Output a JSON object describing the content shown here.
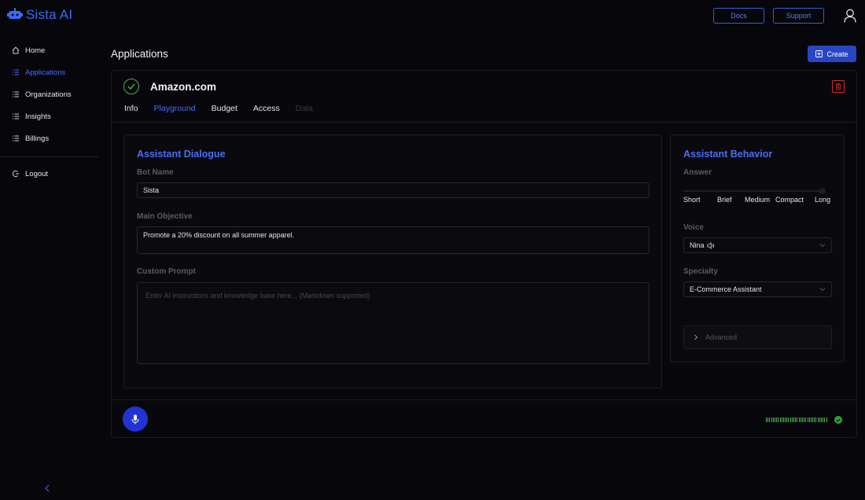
{
  "brand": {
    "name": "Sista AI",
    "accent": "#3b6cf6"
  },
  "sidebar": {
    "items": [
      {
        "label": "Home",
        "icon": "home-icon",
        "active": false
      },
      {
        "label": "Applications",
        "icon": "list-icon",
        "active": true
      },
      {
        "label": "Organizations",
        "icon": "list-icon",
        "active": false
      },
      {
        "label": "Insights",
        "icon": "list-icon",
        "active": false
      },
      {
        "label": "Billings",
        "icon": "list-icon",
        "active": false
      }
    ],
    "logout_label": "Logout",
    "collapse_icon": "chevron-left-icon"
  },
  "header": {
    "docs_label": "Docs",
    "support_label": "Support",
    "user_icon": "user-icon"
  },
  "page": {
    "title": "Applications",
    "create_label": "Create"
  },
  "app": {
    "name": "Amazon.com",
    "status_color": "#4caf50",
    "tabs": [
      {
        "label": "Info",
        "state": "normal"
      },
      {
        "label": "Playground",
        "state": "active"
      },
      {
        "label": "Budget",
        "state": "normal"
      },
      {
        "label": "Access",
        "state": "normal"
      },
      {
        "label": "Data",
        "state": "disabled"
      }
    ]
  },
  "dialogue": {
    "title": "Assistant Dialogue",
    "bot_name_label": "Bot Name",
    "bot_name_value": "Sista",
    "objective_label": "Main Objective",
    "objective_value": "Promote a 20% discount on all summer apparel.",
    "custom_prompt_label": "Custom Prompt",
    "custom_prompt_placeholder": "Enter AI instructions and knowledge base here... (Markdown supported)"
  },
  "behavior": {
    "title": "Assistant Behavior",
    "answer_label": "Answer",
    "answer_levels": [
      "Short",
      "Brief",
      "Medium",
      "Compact",
      "Long"
    ],
    "answer_selected": "Long",
    "voice_label": "Voice",
    "voice_value": "Nina",
    "specialty_label": "Specialty",
    "specialty_value": "E-Commerce Assistant",
    "advanced_label": "Advanced"
  },
  "footer": {
    "mic_icon": "microphone-icon",
    "meter_color": "#4caf50"
  }
}
